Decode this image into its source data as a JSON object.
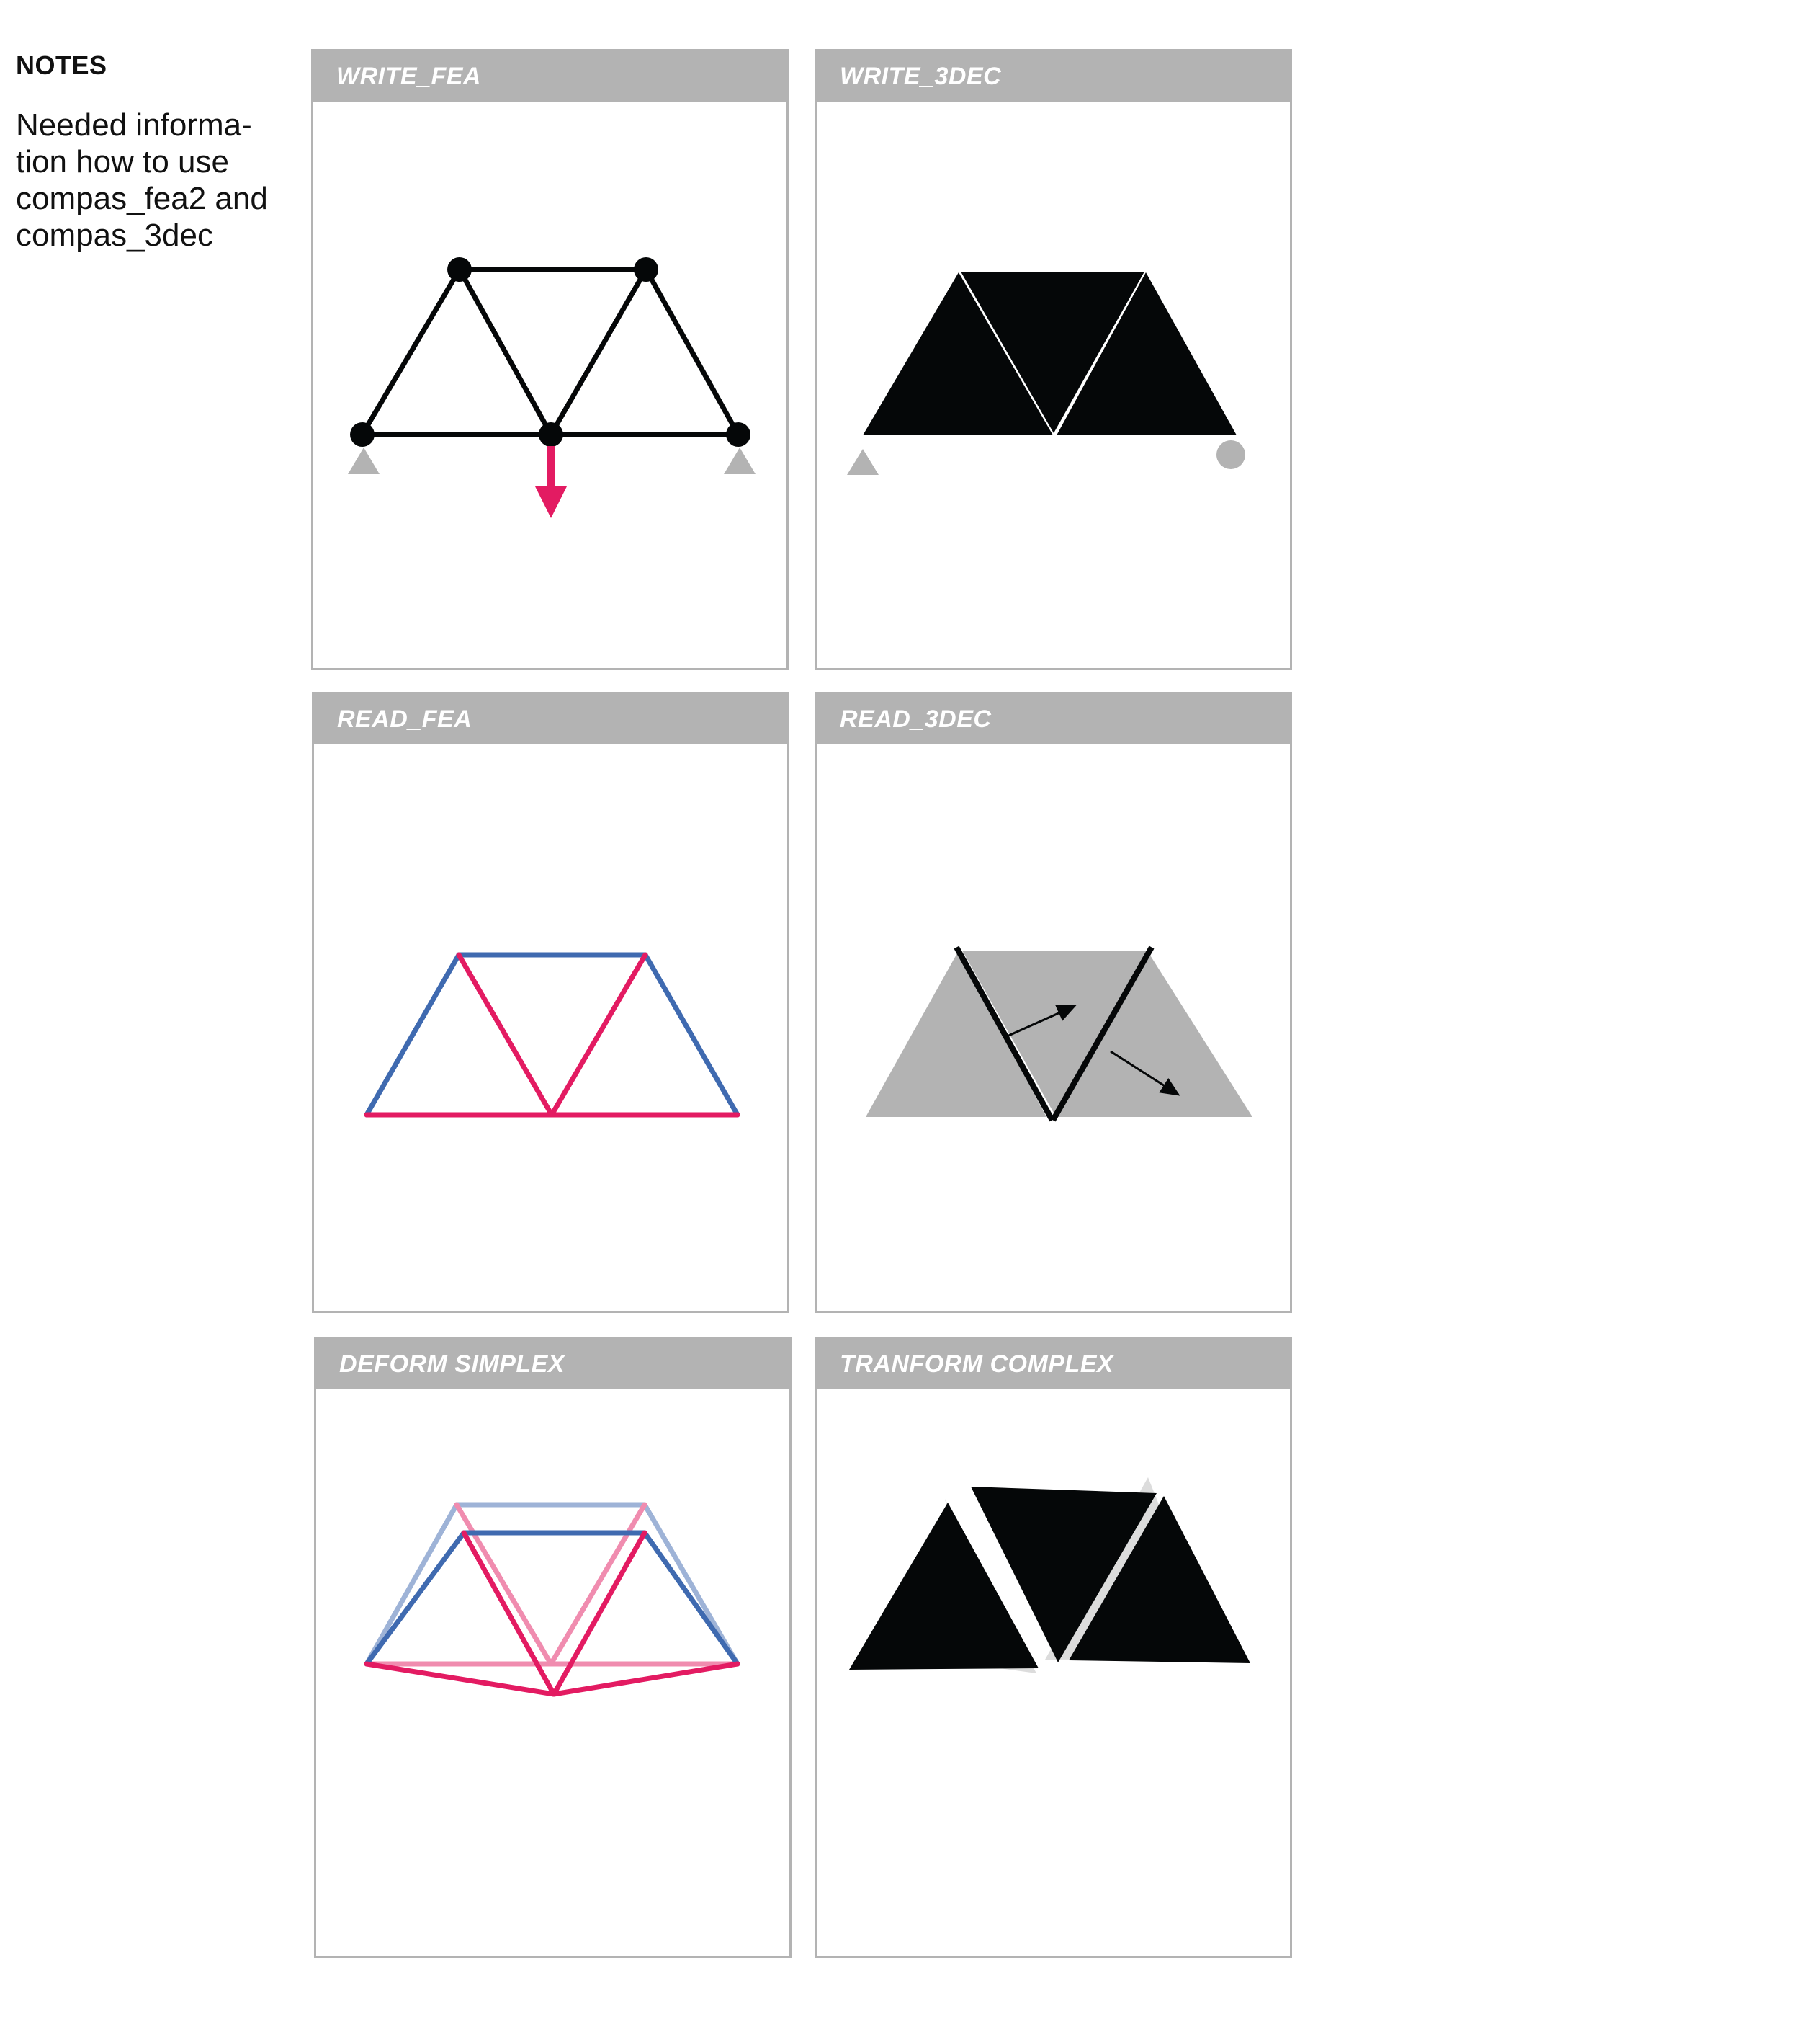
{
  "notes": {
    "title": "NOTES",
    "body": "Needed informa-\ntion how to use\ncompas_fea2 and\ncompas_3dec"
  },
  "panels": [
    {
      "title": "WRITE_FEA"
    },
    {
      "title": "WRITE_3DEC"
    },
    {
      "title": "READ_FEA"
    },
    {
      "title": "READ_3DEC"
    },
    {
      "title": "DEFORM SIMPLEX"
    },
    {
      "title": "TRANFORM COMPLEX"
    }
  ],
  "colors": {
    "header_gray": "#b3b3b3",
    "support_gray": "#b3b3b3",
    "load_pink": "#e31b62",
    "compression_blue": "#3f6ab0",
    "tension_pink": "#e31b62",
    "block_black": "#050708",
    "block_gray": "#b3b3b3",
    "ghost_gray": "#dcdcdc"
  }
}
